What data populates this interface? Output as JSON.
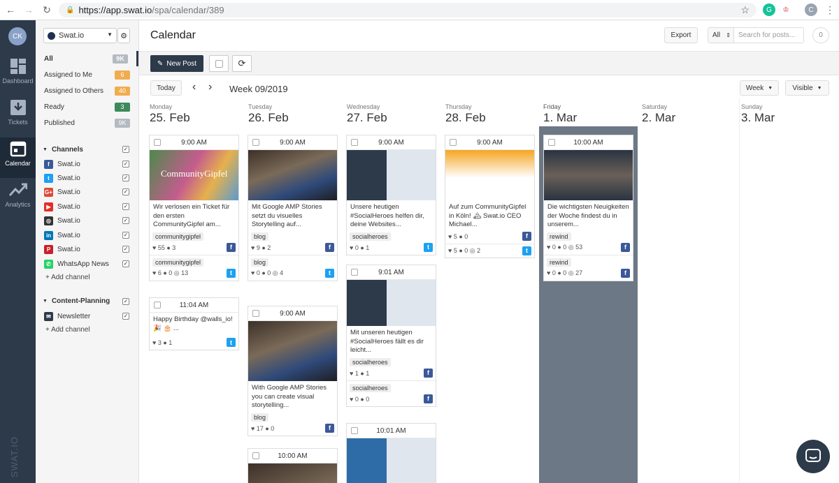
{
  "browser": {
    "url_main": "https://app.swat.io",
    "url_path": "/spa/calendar/389"
  },
  "rail": {
    "avatar": "CK",
    "items": [
      {
        "label": "Dashboard",
        "icon": "dashboard-icon"
      },
      {
        "label": "Tickets",
        "icon": "tickets-icon"
      },
      {
        "label": "Calendar",
        "icon": "calendar-icon"
      },
      {
        "label": "Analytics",
        "icon": "analytics-icon"
      }
    ],
    "brand": "SWAT.IO"
  },
  "sidebar": {
    "account": "Swat.io",
    "filters": [
      {
        "label": "All",
        "count": "9K",
        "color": "#b3bac2"
      },
      {
        "label": "Assigned to Me",
        "count": "6",
        "color": "#f0ad4e"
      },
      {
        "label": "Assigned to Others",
        "count": "40",
        "color": "#f0ad4e"
      },
      {
        "label": "Ready",
        "count": "3",
        "color": "#3c8a5a"
      },
      {
        "label": "Published",
        "count": "9K",
        "color": "#b3bac2"
      }
    ],
    "channels_title": "Channels",
    "channels": [
      {
        "label": "Swat.io",
        "icon": "facebook-icon",
        "glyph": "f",
        "color": "#3b5998"
      },
      {
        "label": "Swat.io",
        "icon": "twitter-icon",
        "glyph": "t",
        "color": "#1da1f2"
      },
      {
        "label": "Swat.io",
        "icon": "google-plus-icon",
        "glyph": "G+",
        "color": "#dd4b39"
      },
      {
        "label": "Swat.io",
        "icon": "youtube-icon",
        "glyph": "▶",
        "color": "#e52d27"
      },
      {
        "label": "Swat.io",
        "icon": "instagram-icon",
        "glyph": "◎",
        "color": "#333333"
      },
      {
        "label": "Swat.io",
        "icon": "linkedin-icon",
        "glyph": "in",
        "color": "#0077b5"
      },
      {
        "label": "Swat.io",
        "icon": "pinterest-icon",
        "glyph": "P",
        "color": "#cb2027"
      },
      {
        "label": "WhatsApp News",
        "icon": "whatsapp-icon",
        "glyph": "✆",
        "color": "#25d366"
      }
    ],
    "add_channel": "+ Add channel",
    "planning_title": "Content-Planning",
    "planning_items": [
      {
        "label": "Newsletter",
        "icon": "newsletter-icon"
      }
    ],
    "add_channel2": "+ Add channel"
  },
  "header": {
    "title": "Calendar",
    "export": "Export",
    "filter": "All",
    "search_placeholder": "Search for posts...",
    "count": "0"
  },
  "toolbar": {
    "new_post": "New Post"
  },
  "nav": {
    "today": "Today",
    "prev": "‹",
    "next": "›",
    "week": "Week 09/2019",
    "view": "Week",
    "visibility": "Visible"
  },
  "days": [
    {
      "name": "Monday",
      "date": "25. Feb"
    },
    {
      "name": "Tuesday",
      "date": "26. Feb"
    },
    {
      "name": "Wednesday",
      "date": "27. Feb"
    },
    {
      "name": "Thursday",
      "date": "28. Feb"
    },
    {
      "name": "Friday",
      "date": "1. Mar"
    },
    {
      "name": "Saturday",
      "date": "2. Mar"
    },
    {
      "name": "Sunday",
      "date": "3. Mar"
    }
  ],
  "cards": {
    "mon1": {
      "time": "9:00 AM",
      "image_text": "CommunityGipfel",
      "text": "Wir verlosen ein Ticket für den ersten CommunityGipfel am...",
      "tag1": "communitygipfel",
      "stat1": "♥ 55  ● 3",
      "tag2": "communitygipfel",
      "stat2": "♥ 6  ● 0  ◎ 13"
    },
    "mon2": {
      "time": "11:04 AM",
      "text": "Happy Birthday @walls_io! 🎉 🎂 ...",
      "stat1": "♥ 3  ● 1"
    },
    "tue1": {
      "time": "9:00 AM",
      "text": "Mit Google AMP Stories setzt du visuelles Storytelling auf...",
      "tag1": "blog",
      "stat1": "♥ 9  ● 2",
      "tag2": "blog",
      "stat2": "♥ 0  ● 0  ◎ 4"
    },
    "tue2": {
      "time": "9:00 AM",
      "text": "With Google AMP Stories you can create visual storytelling...",
      "tag1": "blog",
      "stat1": "♥ 17  ● 0"
    },
    "tue3": {
      "time": "10:00 AM"
    },
    "wed1": {
      "time": "9:00 AM",
      "text": "Unsere heutigen #SocialHeroes helfen dir, deine Websites...",
      "tag1": "socialheroes",
      "stat1": "♥ 0  ● 1"
    },
    "wed2": {
      "time": "9:01 AM",
      "text": "Mit unseren heutigen #SocialHeroes fällt es dir leicht...",
      "tag1": "socialheroes",
      "stat1": "♥ 1  ● 1",
      "tag2": "socialheroes",
      "stat2": "♥ 0  ● 0"
    },
    "wed3": {
      "time": "10:01 AM"
    },
    "thu1": {
      "time": "9:00 AM",
      "text": "Auf zum CommunityGipfel in Köln! 🏔 Swat.io CEO Michael...",
      "stat1": "♥ 5  ● 0",
      "stat2": "♥ 5  ● 0  ◎ 2"
    },
    "fri1": {
      "time": "10:00 AM",
      "text": "Die wichtigsten Neuigkeiten der Woche findest du in unserem...",
      "tag1": "rewind",
      "stat1": "♥ 0  ● 0  ◎ 53",
      "tag2": "rewind",
      "stat2": "♥ 0  ● 0  ◎ 27"
    }
  }
}
